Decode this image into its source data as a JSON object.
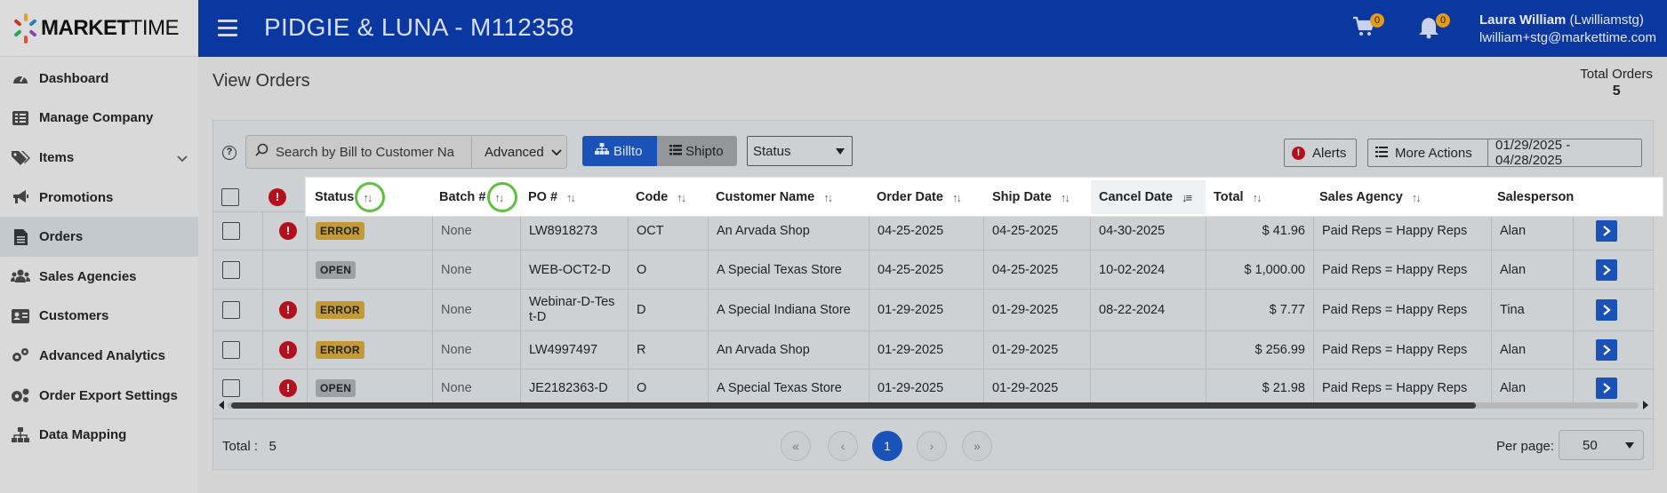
{
  "brand": {
    "bold": "MARKET",
    "thin": "TIME"
  },
  "header": {
    "title": "PIDGIE & LUNA - M112358",
    "cart_count": "0",
    "notif_count": "0",
    "user_name": "Laura William",
    "user_handle": "(Lwilliamstg)",
    "user_email": "lwilliam+stg@markettime.com"
  },
  "sidebar": {
    "items": [
      {
        "label": "Dashboard",
        "icon": "gauge-icon"
      },
      {
        "label": "Manage Company",
        "icon": "list-icon"
      },
      {
        "label": "Items",
        "icon": "tags-icon"
      },
      {
        "label": "Promotions",
        "icon": "megaphone-icon"
      },
      {
        "label": "Orders",
        "icon": "document-icon"
      },
      {
        "label": "Sales Agencies",
        "icon": "users-icon"
      },
      {
        "label": "Customers",
        "icon": "id-card-icon"
      },
      {
        "label": "Advanced Analytics",
        "icon": "gears-icon"
      },
      {
        "label": "Order Export Settings",
        "icon": "cogs-icon"
      },
      {
        "label": "Data Mapping",
        "icon": "sitemap-icon"
      }
    ],
    "active": "Orders"
  },
  "page": {
    "title": "View Orders",
    "total_orders_label": "Total Orders",
    "total_orders_value": "5"
  },
  "toolbar": {
    "help": "?",
    "search_placeholder": "Search by Bill to Customer Na",
    "advanced_label": "Advanced",
    "billto_label": "Billto",
    "shipto_label": "Shipto",
    "status_label": "Status",
    "alerts_label": "Alerts",
    "more_actions_label": "More Actions",
    "date_range": "01/29/2025 - 04/28/2025"
  },
  "table": {
    "headers": [
      "Status",
      "Batch #",
      "PO #",
      "Code",
      "Customer Name",
      "Order Date",
      "Ship Date",
      "Cancel Date",
      "Total",
      "Sales Agency",
      "Salesperson"
    ],
    "rows": [
      {
        "alert": true,
        "status": "ERROR",
        "batch": "None",
        "po": "LW8918273",
        "code": "OCT",
        "customer": "An Arvada Shop",
        "order_date": "04-25-2025",
        "ship_date": "04-25-2025",
        "cancel_date": "04-30-2025",
        "total": "$ 41.96",
        "agency": "Paid Reps = Happy Reps",
        "salesperson": "Alan"
      },
      {
        "alert": false,
        "status": "OPEN",
        "batch": "None",
        "po": "WEB-OCT2-D",
        "code": "O",
        "customer": "A Special Texas Store",
        "order_date": "04-25-2025",
        "ship_date": "04-25-2025",
        "cancel_date": "10-02-2024",
        "total": "$ 1,000.00",
        "agency": "Paid Reps = Happy Reps",
        "salesperson": "Alan"
      },
      {
        "alert": true,
        "status": "ERROR",
        "batch": "None",
        "po": "Webinar-D-Test-D",
        "po_line1": "Webinar-D-Tes",
        "po_line2": "t-D",
        "code": "D",
        "customer": "A Special Indiana Store",
        "order_date": "01-29-2025",
        "ship_date": "01-29-2025",
        "cancel_date": "08-22-2024",
        "total": "$ 7.77",
        "agency": "Paid Reps = Happy Reps",
        "salesperson": "Tina"
      },
      {
        "alert": true,
        "status": "ERROR",
        "batch": "None",
        "po": "LW4997497",
        "code": "R",
        "customer": "An Arvada Shop",
        "order_date": "01-29-2025",
        "ship_date": "01-29-2025",
        "cancel_date": "",
        "total": "$ 256.99",
        "agency": "Paid Reps = Happy Reps",
        "salesperson": "Alan"
      },
      {
        "alert": true,
        "status": "OPEN",
        "batch": "None",
        "po": "JE2182363-D",
        "code": "O",
        "customer": "A Special Texas Store",
        "order_date": "01-29-2025",
        "ship_date": "01-29-2025",
        "cancel_date": "",
        "total": "$ 21.98",
        "agency": "Paid Reps = Happy Reps",
        "salesperson": "Alan"
      }
    ]
  },
  "footer": {
    "total_label": "Total :",
    "total_value": "5",
    "current_page": "1",
    "per_page_label": "Per page:",
    "per_page_value": "50"
  },
  "colors": {
    "brand_blue": "#0b37a0",
    "accent_blue": "#1a52b8",
    "error_red": "#b40f1d",
    "error_pill": "#c39a35",
    "badge_orange": "#e39b1b",
    "highlight_green": "#5cc23e"
  }
}
